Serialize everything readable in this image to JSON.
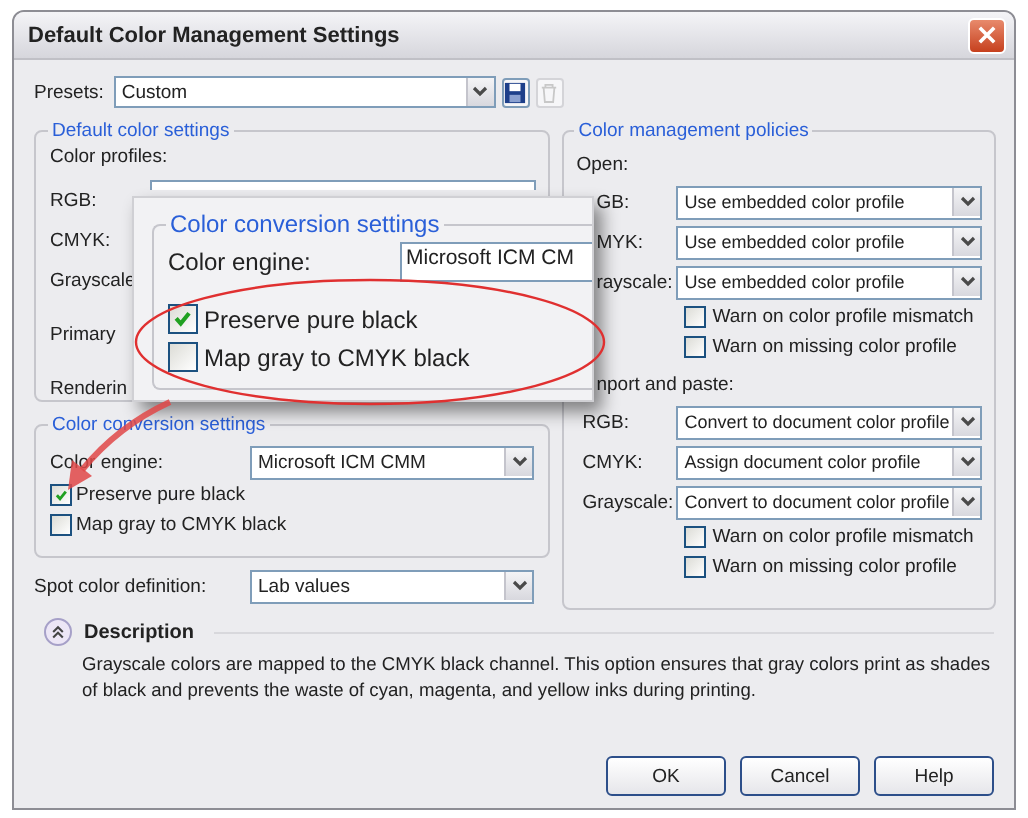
{
  "window": {
    "title": "Default Color Management Settings"
  },
  "presets": {
    "label": "Presets:",
    "value": "Custom"
  },
  "default_color_settings": {
    "title": "Default color settings",
    "profiles_label": "Color profiles:",
    "rows": [
      {
        "label": "RGB:"
      },
      {
        "label": "CMYK:"
      },
      {
        "label": "Grayscale"
      },
      {
        "label": "Primary"
      },
      {
        "label": "Renderin"
      }
    ]
  },
  "color_conversion": {
    "title": "Color conversion settings",
    "engine_label": "Color engine:",
    "engine_value": "Microsoft ICM CMM",
    "options": [
      {
        "label": "Preserve pure black",
        "checked": true
      },
      {
        "label": "Map gray to CMYK black",
        "checked": false
      }
    ]
  },
  "spot_color": {
    "label": "Spot color definition:",
    "value": "Lab values"
  },
  "policies": {
    "title": "Color management policies",
    "sections": [
      {
        "heading": "Open:",
        "rows": [
          {
            "label": "GB:",
            "value": "Use embedded color profile"
          },
          {
            "label": "MYK:",
            "value": "Use embedded color profile"
          },
          {
            "label": "rayscale:",
            "value": "Use embedded color profile"
          }
        ],
        "warnings": [
          {
            "label": "Warn on color profile mismatch",
            "checked": false
          },
          {
            "label": "Warn on missing color profile",
            "checked": false
          }
        ]
      },
      {
        "heading": "nport and paste:",
        "rows": [
          {
            "label": "RGB:",
            "value": "Convert to document color profile"
          },
          {
            "label": "CMYK:",
            "value": "Assign document color profile"
          },
          {
            "label": "Grayscale:",
            "value": "Convert to document color profile"
          }
        ],
        "warnings": [
          {
            "label": "Warn on color profile mismatch",
            "checked": false
          },
          {
            "label": "Warn on missing color profile",
            "checked": false
          }
        ]
      }
    ]
  },
  "description": {
    "title": "Description",
    "text": "Grayscale colors are mapped to the CMYK black channel. This option ensures that gray colors print as shades of black and prevents the waste of cyan, magenta, and yellow inks during printing."
  },
  "buttons": [
    "OK",
    "Cancel",
    "Help"
  ],
  "callout": {
    "title": "Color conversion settings",
    "engine_label": "Color engine:",
    "engine_value": "Microsoft ICM CM",
    "options": [
      {
        "label": "Preserve pure black",
        "checked": true
      },
      {
        "label": "Map gray to CMYK black",
        "checked": false
      }
    ]
  }
}
